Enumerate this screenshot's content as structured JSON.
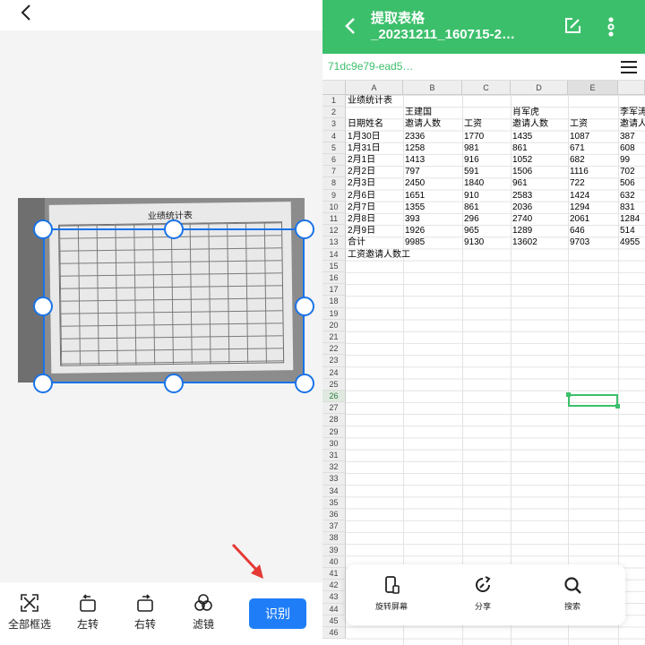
{
  "left": {
    "tools": [
      {
        "label": "全部框选",
        "icon": "select-all-icon"
      },
      {
        "label": "左转",
        "icon": "rotate-left-icon"
      },
      {
        "label": "右转",
        "icon": "rotate-right-icon"
      },
      {
        "label": "滤镜",
        "icon": "filter-icon"
      }
    ],
    "recognize_label": "识别",
    "document_title": "业绩统计表"
  },
  "right": {
    "title_line1": "提取表格",
    "title_line2": "_20231211_160715-2…",
    "file_id": "71dc9e79-ead5…",
    "columns": [
      "A",
      "B",
      "C",
      "D",
      "E"
    ],
    "rows": [
      [
        "业绩统计表",
        "",
        "",
        "",
        "",
        ""
      ],
      [
        "",
        "王建国",
        "",
        "肖军虎",
        "",
        "李军涛"
      ],
      [
        "日期姓名",
        "邀请人数",
        "工资",
        "邀请人数",
        "工资",
        "邀请人"
      ],
      [
        "1月30日",
        "2336",
        "1770",
        "1435",
        "1087",
        "387"
      ],
      [
        "1月31日",
        "1258",
        "981",
        "861",
        "671",
        "608"
      ],
      [
        "2月1日",
        "1413",
        "916",
        "1052",
        "682",
        "99"
      ],
      [
        "2月2日",
        "797",
        "591",
        "1506",
        "1116",
        "702"
      ],
      [
        "2月3日",
        "2450",
        "1840",
        "961",
        "722",
        "506"
      ],
      [
        "2月6日",
        "1651",
        "910",
        "2583",
        "1424",
        "632"
      ],
      [
        "2月7日",
        "1355",
        "861",
        "2036",
        "1294",
        "831"
      ],
      [
        "2月8日",
        "393",
        "296",
        "2740",
        "2061",
        "1284"
      ],
      [
        "2月9日",
        "1926",
        "965",
        "1289",
        "646",
        "514"
      ],
      [
        "合计",
        "9985",
        "9130",
        "13602",
        "9703",
        "4955"
      ],
      [
        "工资邀请人数工",
        "",
        "",
        "",
        "",
        ""
      ]
    ],
    "row_count": 46,
    "selected_row": "26",
    "toolbar": [
      {
        "label": "旋转屏幕",
        "icon": "rotate-screen-icon"
      },
      {
        "label": "分享",
        "icon": "share-icon"
      },
      {
        "label": "搜索",
        "icon": "search-icon"
      }
    ]
  }
}
